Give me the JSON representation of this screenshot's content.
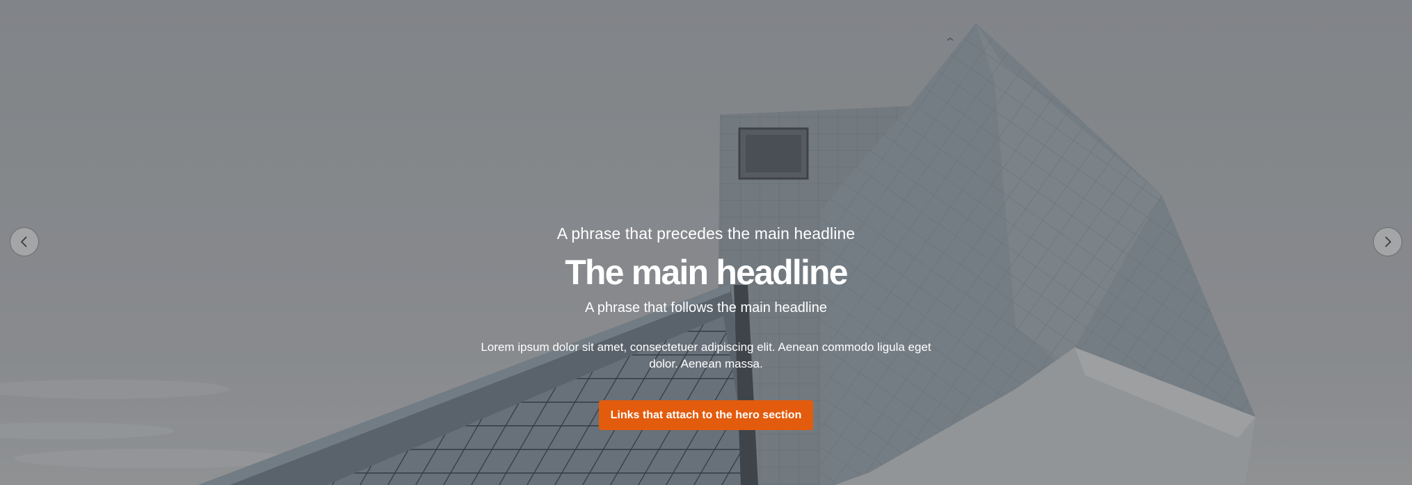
{
  "hero": {
    "pre_headline": "A phrase that precedes the main headline",
    "headline": "The main headline",
    "post_headline": "A phrase that follows the main headline",
    "body": "Lorem ipsum dolor sit amet, consectetuer adipiscing elit. Aenean commodo ligula eget dolor. Aenean massa.",
    "cta_label": "Links that attach to the hero section",
    "cta_color": "#e35b0c",
    "background_image": "building-icon"
  },
  "carousel": {
    "prev_icon": "chevron-left-icon",
    "next_icon": "chevron-right-icon"
  }
}
